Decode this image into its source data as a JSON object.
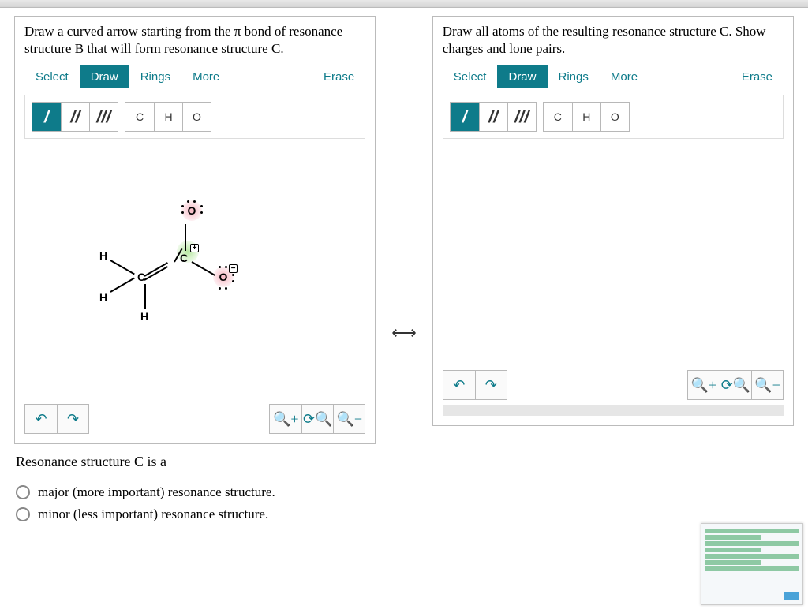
{
  "panelA": {
    "prompt": "Draw a curved arrow starting from the π bond of resonance structure B that will form resonance structure C.",
    "tabs": {
      "select": "Select",
      "draw": "Draw",
      "rings": "Rings",
      "more": "More"
    },
    "erase": "Erase",
    "atoms": {
      "c": "C",
      "h": "H",
      "o": "O"
    }
  },
  "panelB": {
    "prompt": "Draw all atoms of the resulting resonance structure C. Show charges and lone pairs.",
    "tabs": {
      "select": "Select",
      "draw": "Draw",
      "rings": "Rings",
      "more": "More"
    },
    "erase": "Erase",
    "atoms": {
      "c": "C",
      "h": "H",
      "o": "O"
    }
  },
  "molecule": {
    "labels": {
      "O_top": "O",
      "C_right": "C",
      "O_right": "O",
      "C_left": "C",
      "H_topleft": "H",
      "H_botleft": "H",
      "H_bottom": "H"
    },
    "charges": {
      "C_right": "+",
      "O_right": "−"
    }
  },
  "question": {
    "title": "Resonance structure C is a",
    "opt1": "major (more important) resonance structure.",
    "opt2": "minor (less important) resonance structure."
  },
  "icons": {
    "resonance_arrow": "⟷",
    "undo": "↶",
    "redo": "↷",
    "zoom_in": "⊕",
    "zoom_reset": "⟳",
    "zoom_out": "⊖"
  }
}
